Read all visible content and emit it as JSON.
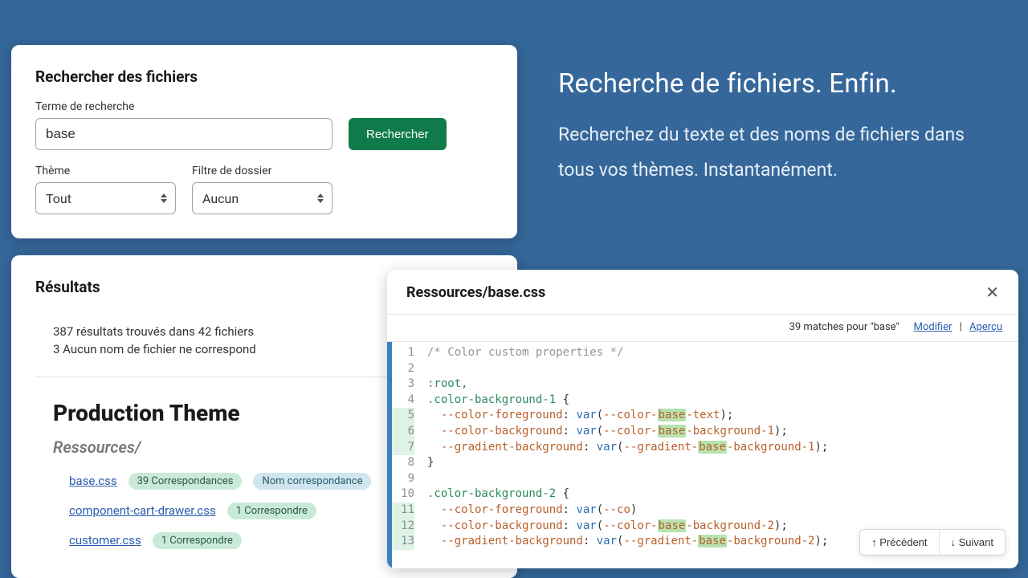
{
  "hero": {
    "title": "Recherche de fichiers. Enfin.",
    "subtitle": "Recherchez du texte et des noms de fichiers dans tous vos thèmes. Instantanément."
  },
  "search_panel": {
    "title": "Rechercher des fichiers",
    "term_label": "Terme de recherche",
    "term_value": "base",
    "search_button": "Rechercher",
    "theme_label": "Thème",
    "theme_value": "Tout",
    "folder_label": "Filtre de dossier",
    "folder_value": "Aucun"
  },
  "results_panel": {
    "title": "Résultats",
    "summary_line1": "387 résultats trouvés dans 42 fichiers",
    "summary_line2": "3 Aucun nom de fichier ne correspond",
    "theme_title": "Production Theme",
    "folder_title": "Ressources/",
    "files": [
      {
        "name": "base.css",
        "matches_pill": "39 Correspondances",
        "name_pill": "Nom correspondance"
      },
      {
        "name": "component-cart-drawer.css",
        "matches_pill": "1 Correspondre"
      },
      {
        "name": "customer.css",
        "matches_pill": "1 Correspondre"
      }
    ]
  },
  "code_panel": {
    "title": "Ressources/base.css",
    "matches_text": "39 matches pour \"base\"",
    "edit_link": "Modifier",
    "preview_link": "Aperçu",
    "prev_button": "↑ Précédent",
    "next_button": "↓ Suivant",
    "highlight_lines": [
      5,
      6,
      7,
      11,
      12,
      13
    ],
    "lines": [
      {
        "n": 1,
        "type": "comment",
        "text": "/* Color custom properties */"
      },
      {
        "n": 2,
        "type": "blank",
        "text": ""
      },
      {
        "n": 3,
        "type": "sel",
        "text": ":root,"
      },
      {
        "n": 4,
        "type": "selopen",
        "sel": ".color-background-1"
      },
      {
        "n": 5,
        "type": "prop",
        "prop": "--color-foreground",
        "val_pre": "--color-",
        "val_hl": "base",
        "val_post": "-text"
      },
      {
        "n": 6,
        "type": "prop",
        "prop": "--color-background",
        "val_pre": "--color-",
        "val_hl": "base",
        "val_post": "-background-1"
      },
      {
        "n": 7,
        "type": "prop",
        "prop": "--gradient-background",
        "val_pre": "--gradient-",
        "val_hl": "base",
        "val_post": "-background-1"
      },
      {
        "n": 8,
        "type": "close",
        "text": "}"
      },
      {
        "n": 9,
        "type": "blank",
        "text": ""
      },
      {
        "n": 10,
        "type": "selopen",
        "sel": ".color-background-2"
      },
      {
        "n": 11,
        "type": "prop",
        "prop": "--color-foreground",
        "val_pre": "--co",
        "val_hl": "",
        "val_post": "",
        "truncated": true
      },
      {
        "n": 12,
        "type": "prop",
        "prop": "--color-background",
        "val_pre": "--color-",
        "val_hl": "base",
        "val_post": "-background-2"
      },
      {
        "n": 13,
        "type": "prop",
        "prop": "--gradient-background",
        "val_pre": "--gradient-",
        "val_hl": "base",
        "val_post": "-background-2"
      }
    ]
  }
}
